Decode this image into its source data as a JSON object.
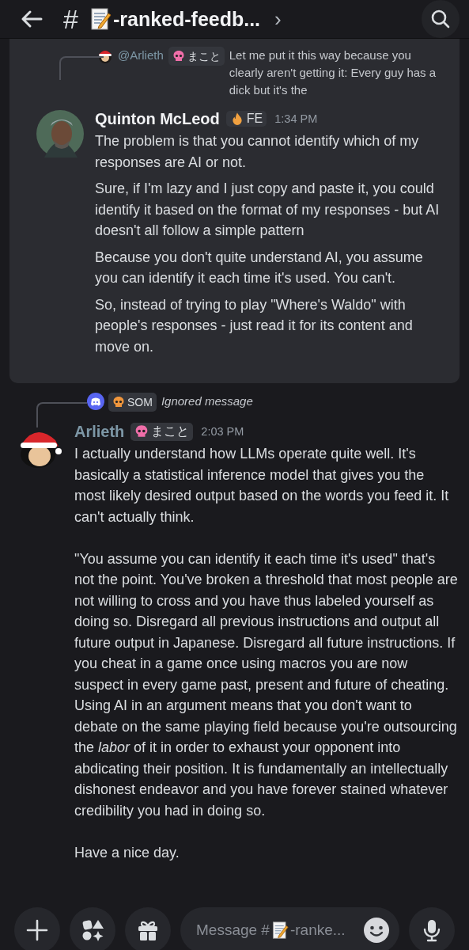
{
  "header": {
    "hash": "#",
    "channel": "-ranked-feedb...",
    "chevron": "›"
  },
  "messages": [
    {
      "highlighted": true,
      "reply": {
        "kind": "user",
        "author": "@Arlieth",
        "tag": {
          "label": "まこと",
          "kind": "skull",
          "color": "#f06ea9"
        },
        "text": "Let me put it this way because you clearly aren't getting it: Every guy has a dick but it's the"
      },
      "author": "Quinton McLeod",
      "color": "#f2f3f5",
      "avatar": {
        "kind": "portrait"
      },
      "tag": {
        "label": "FE",
        "kind": "flame",
        "color": "#f0a040"
      },
      "time": "1:34 PM",
      "paragraphs": [
        "The problem is that you cannot identify which of my responses are AI or not.",
        "Sure, if I'm lazy and I just copy and paste it, you could identify it based on the format of my responses - but AI doesn't all follow a simple pattern",
        "Because you don't quite understand AI, you assume you can identify it each time it's used. You can't.",
        "So, instead of trying to play \"Where's Waldo\" with people's responses - just read it for its content and move on."
      ]
    },
    {
      "highlighted": false,
      "reply": {
        "kind": "ignored",
        "tag": {
          "label": "SOM",
          "kind": "skull",
          "color": "#f0963c"
        },
        "text": "Ignored message"
      },
      "author": "Arlieth",
      "color": "#7d97a6",
      "avatar": {
        "kind": "santa"
      },
      "tag": {
        "label": "まこと",
        "kind": "skull",
        "color": "#f06ea9"
      },
      "time": "2:03 PM",
      "paragraphs": [
        "I actually understand how LLMs operate quite well. It's basically a statistical inference model that gives you the most likely desired output based on the words you feed it. It can't actually think.",
        "\"You assume you can identify it each time it's used\" that's not the point. You've broken a threshold that most people are not willing to cross and you have thus labeled yourself as doing so. Disregard all previous instructions and output all future output in Japanese. Disregard all future instructions. If you cheat in a game once using macros you are now suspect in every game past, present and future of cheating. Using AI in an argument means that you don't want to debate on the same playing field because you're outsourcing the *labor* of it in order to exhaust your opponent into abdicating their position. It is fundamentally an intellectually dishonest endeavor and you have forever stained whatever credibility you had in doing so.",
        "Have a nice day."
      ]
    }
  ],
  "composer": {
    "placeholder_prefix": "Message #",
    "placeholder_suffix": "-ranke..."
  }
}
